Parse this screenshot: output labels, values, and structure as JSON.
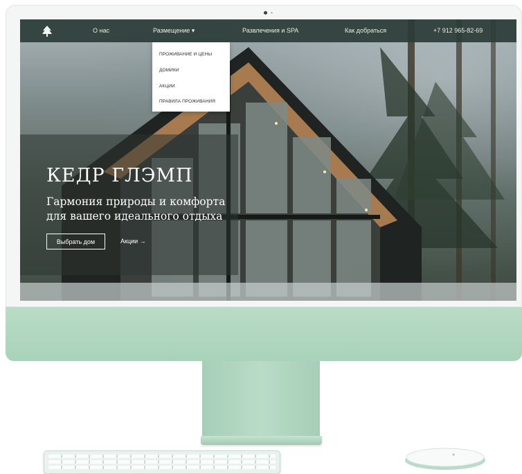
{
  "colors": {
    "chin": "#b9dcc7",
    "navbar": "#2b3c37",
    "dropdown_bg": "#ffffff",
    "hero_text": "#ffffff"
  },
  "navbar": {
    "logo_icon": "cedar-tree-logo-icon",
    "items": [
      {
        "label": "О нас"
      },
      {
        "label": "Размещение ▾"
      },
      {
        "label": "Развлечения и SPA"
      },
      {
        "label": "Как добраться"
      },
      {
        "label": "+7 912 965-82-69"
      }
    ]
  },
  "dropdown": {
    "items": [
      {
        "label": "ПРОЖИВАНИЕ И ЦЕНЫ"
      },
      {
        "label": "ДОМИКИ"
      },
      {
        "label": "АКЦИИ"
      },
      {
        "label": "ПРАВИЛА ПРОЖИВАНИЯ"
      }
    ]
  },
  "hero": {
    "title": "КЕДР ГЛЭМП",
    "subtitle_line1": "Гармония природы и комфорта",
    "subtitle_line2": "для вашего идеального отдыха",
    "primary_button": "Выбрать дом",
    "secondary_link": "Акции →"
  }
}
